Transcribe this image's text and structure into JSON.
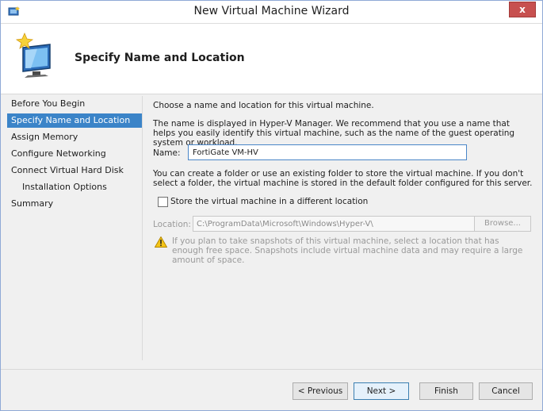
{
  "window": {
    "title": "New Virtual Machine Wizard",
    "close_label": "x"
  },
  "header": {
    "title": "Specify Name and Location"
  },
  "nav": {
    "items": [
      {
        "label": "Before You Begin",
        "active": false
      },
      {
        "label": "Specify Name and Location",
        "active": true
      },
      {
        "label": "Assign Memory",
        "active": false
      },
      {
        "label": "Configure Networking",
        "active": false
      },
      {
        "label": "Connect Virtual Hard Disk",
        "active": false
      },
      {
        "label": "Installation Options",
        "active": false,
        "sub": true
      },
      {
        "label": "Summary",
        "active": false
      }
    ]
  },
  "content": {
    "intro": "Choose a name and location for this virtual machine.",
    "name_help": "The name is displayed in Hyper-V Manager. We recommend that you use a name that helps you easily identify this virtual machine, such as the name of the guest operating system or workload.",
    "name_label": "Name:",
    "name_value": "FortiGate VM-HV",
    "folder_help": "You can create a folder or use an existing folder to store the virtual machine. If you don't select a folder, the virtual machine is stored in the default folder configured for this server.",
    "store_checkbox_label": "Store the virtual machine in a different location",
    "store_checked": false,
    "location_label": "Location:",
    "location_value": "C:\\ProgramData\\Microsoft\\Windows\\Hyper-V\\",
    "browse_label": "Browse...",
    "warning": "If you plan to take snapshots of this virtual machine, select a location that has enough free space. Snapshots include virtual machine data and may require a large amount of space."
  },
  "footer": {
    "previous": "< Previous",
    "next": "Next >",
    "finish": "Finish",
    "cancel": "Cancel"
  },
  "colors": {
    "accent": "#3b84c8",
    "close": "#c7504f"
  },
  "icons": {
    "app": "hyper-v-icon",
    "wizard": "monitor-sparkle-icon",
    "warning": "warning-triangle-icon"
  }
}
